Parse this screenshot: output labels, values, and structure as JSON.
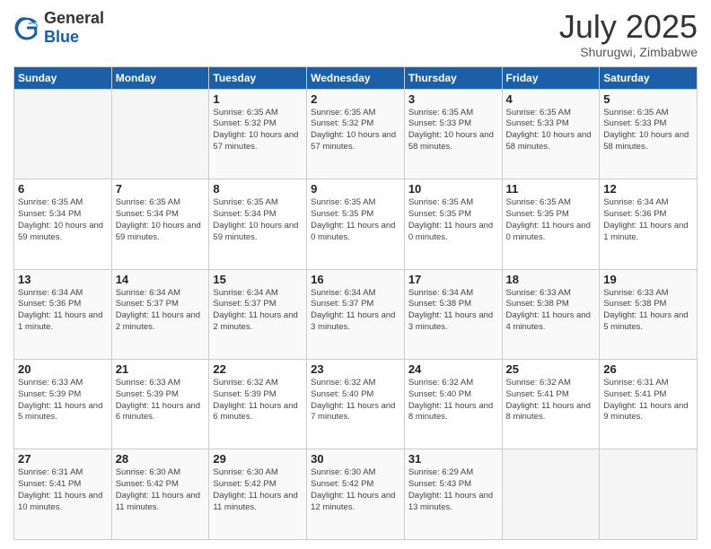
{
  "header": {
    "logo_general": "General",
    "logo_blue": "Blue",
    "month_year": "July 2025",
    "location": "Shurugwi, Zimbabwe"
  },
  "weekdays": [
    "Sunday",
    "Monday",
    "Tuesday",
    "Wednesday",
    "Thursday",
    "Friday",
    "Saturday"
  ],
  "weeks": [
    [
      {
        "day": "",
        "info": ""
      },
      {
        "day": "",
        "info": ""
      },
      {
        "day": "1",
        "info": "Sunrise: 6:35 AM\nSunset: 5:32 PM\nDaylight: 10 hours and 57 minutes."
      },
      {
        "day": "2",
        "info": "Sunrise: 6:35 AM\nSunset: 5:32 PM\nDaylight: 10 hours and 57 minutes."
      },
      {
        "day": "3",
        "info": "Sunrise: 6:35 AM\nSunset: 5:33 PM\nDaylight: 10 hours and 58 minutes."
      },
      {
        "day": "4",
        "info": "Sunrise: 6:35 AM\nSunset: 5:33 PM\nDaylight: 10 hours and 58 minutes."
      },
      {
        "day": "5",
        "info": "Sunrise: 6:35 AM\nSunset: 5:33 PM\nDaylight: 10 hours and 58 minutes."
      }
    ],
    [
      {
        "day": "6",
        "info": "Sunrise: 6:35 AM\nSunset: 5:34 PM\nDaylight: 10 hours and 59 minutes."
      },
      {
        "day": "7",
        "info": "Sunrise: 6:35 AM\nSunset: 5:34 PM\nDaylight: 10 hours and 59 minutes."
      },
      {
        "day": "8",
        "info": "Sunrise: 6:35 AM\nSunset: 5:34 PM\nDaylight: 10 hours and 59 minutes."
      },
      {
        "day": "9",
        "info": "Sunrise: 6:35 AM\nSunset: 5:35 PM\nDaylight: 11 hours and 0 minutes."
      },
      {
        "day": "10",
        "info": "Sunrise: 6:35 AM\nSunset: 5:35 PM\nDaylight: 11 hours and 0 minutes."
      },
      {
        "day": "11",
        "info": "Sunrise: 6:35 AM\nSunset: 5:35 PM\nDaylight: 11 hours and 0 minutes."
      },
      {
        "day": "12",
        "info": "Sunrise: 6:34 AM\nSunset: 5:36 PM\nDaylight: 11 hours and 1 minute."
      }
    ],
    [
      {
        "day": "13",
        "info": "Sunrise: 6:34 AM\nSunset: 5:36 PM\nDaylight: 11 hours and 1 minute."
      },
      {
        "day": "14",
        "info": "Sunrise: 6:34 AM\nSunset: 5:37 PM\nDaylight: 11 hours and 2 minutes."
      },
      {
        "day": "15",
        "info": "Sunrise: 6:34 AM\nSunset: 5:37 PM\nDaylight: 11 hours and 2 minutes."
      },
      {
        "day": "16",
        "info": "Sunrise: 6:34 AM\nSunset: 5:37 PM\nDaylight: 11 hours and 3 minutes."
      },
      {
        "day": "17",
        "info": "Sunrise: 6:34 AM\nSunset: 5:38 PM\nDaylight: 11 hours and 3 minutes."
      },
      {
        "day": "18",
        "info": "Sunrise: 6:33 AM\nSunset: 5:38 PM\nDaylight: 11 hours and 4 minutes."
      },
      {
        "day": "19",
        "info": "Sunrise: 6:33 AM\nSunset: 5:38 PM\nDaylight: 11 hours and 5 minutes."
      }
    ],
    [
      {
        "day": "20",
        "info": "Sunrise: 6:33 AM\nSunset: 5:39 PM\nDaylight: 11 hours and 5 minutes."
      },
      {
        "day": "21",
        "info": "Sunrise: 6:33 AM\nSunset: 5:39 PM\nDaylight: 11 hours and 6 minutes."
      },
      {
        "day": "22",
        "info": "Sunrise: 6:32 AM\nSunset: 5:39 PM\nDaylight: 11 hours and 6 minutes."
      },
      {
        "day": "23",
        "info": "Sunrise: 6:32 AM\nSunset: 5:40 PM\nDaylight: 11 hours and 7 minutes."
      },
      {
        "day": "24",
        "info": "Sunrise: 6:32 AM\nSunset: 5:40 PM\nDaylight: 11 hours and 8 minutes."
      },
      {
        "day": "25",
        "info": "Sunrise: 6:32 AM\nSunset: 5:41 PM\nDaylight: 11 hours and 8 minutes."
      },
      {
        "day": "26",
        "info": "Sunrise: 6:31 AM\nSunset: 5:41 PM\nDaylight: 11 hours and 9 minutes."
      }
    ],
    [
      {
        "day": "27",
        "info": "Sunrise: 6:31 AM\nSunset: 5:41 PM\nDaylight: 11 hours and 10 minutes."
      },
      {
        "day": "28",
        "info": "Sunrise: 6:30 AM\nSunset: 5:42 PM\nDaylight: 11 hours and 11 minutes."
      },
      {
        "day": "29",
        "info": "Sunrise: 6:30 AM\nSunset: 5:42 PM\nDaylight: 11 hours and 11 minutes."
      },
      {
        "day": "30",
        "info": "Sunrise: 6:30 AM\nSunset: 5:42 PM\nDaylight: 11 hours and 12 minutes."
      },
      {
        "day": "31",
        "info": "Sunrise: 6:29 AM\nSunset: 5:43 PM\nDaylight: 11 hours and 13 minutes."
      },
      {
        "day": "",
        "info": ""
      },
      {
        "day": "",
        "info": ""
      }
    ]
  ]
}
